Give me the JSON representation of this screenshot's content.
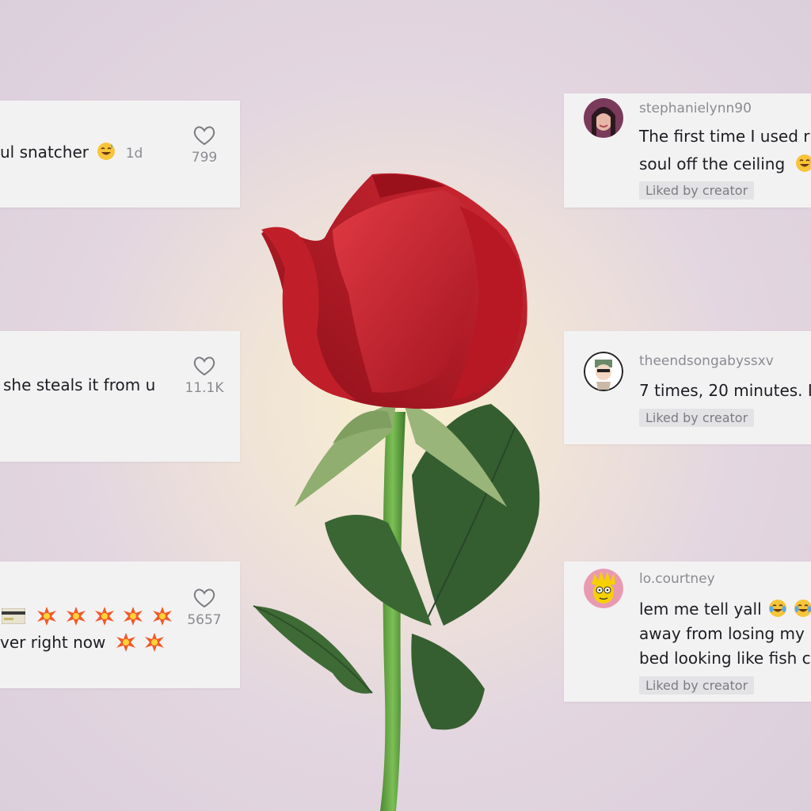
{
  "comments_left": [
    {
      "text": "ul snatcher",
      "ago": "1d",
      "likes": "799"
    },
    {
      "text": "she steals it from u",
      "likes": "11.1K"
    },
    {
      "line1": "",
      "line2": "ver right now",
      "likes": "5657"
    }
  ],
  "comments_right": [
    {
      "username": "stephanielynn90",
      "line1": "The first time I used r",
      "line2": "soul off the ceiling",
      "badge": "Liked by creator"
    },
    {
      "username": "theendsongabyssxv",
      "line1": "7 times, 20 minutes. I",
      "badge": "Liked by creator"
    },
    {
      "username": "lo.courtney",
      "line1": "lem me tell yall",
      "line2": "away from losing my",
      "line3": "bed looking like fish c",
      "badge": "Liked by creator"
    }
  ],
  "colors": {
    "card": "#f3f2f3",
    "rose": "#c8232e",
    "leaf": "#3f6b3a",
    "stem": "#5a9a3e"
  }
}
